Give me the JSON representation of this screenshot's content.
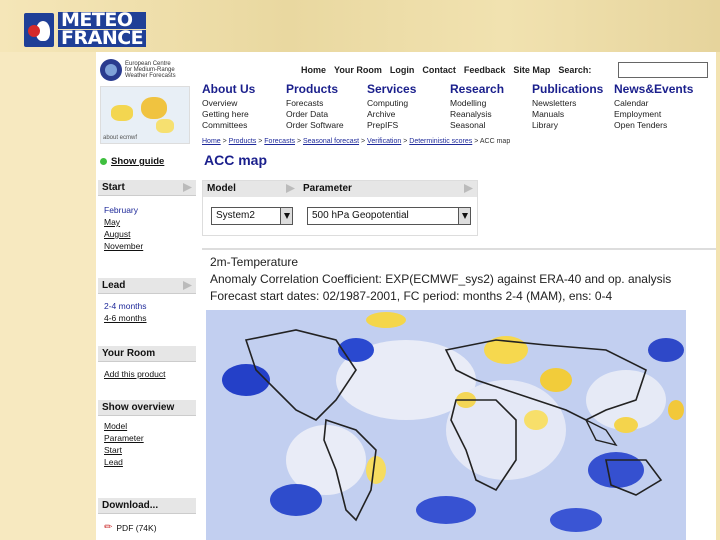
{
  "slide": {
    "logo_line1": "METEO",
    "logo_line2": "FRANCE"
  },
  "ecmwf": {
    "name_lines": [
      "European Centre",
      "for Medium-Range",
      "Weather Forecasts"
    ],
    "thumb_caption": "about ecmwf"
  },
  "topnav": {
    "items": [
      "Home",
      "Your Room",
      "Login",
      "Contact",
      "Feedback",
      "Site Map",
      "Search:"
    ]
  },
  "mainnav": [
    {
      "title": "About Us",
      "items": [
        "Overview",
        "Getting here",
        "Committees"
      ]
    },
    {
      "title": "Products",
      "items": [
        "Forecasts",
        "Order Data",
        "Order Software"
      ]
    },
    {
      "title": "Services",
      "items": [
        "Computing",
        "Archive",
        "PrepIFS"
      ]
    },
    {
      "title": "Research",
      "items": [
        "Modelling",
        "Reanalysis",
        "Seasonal"
      ]
    },
    {
      "title": "Publications",
      "items": [
        "Newsletters",
        "Manuals",
        "Library"
      ]
    },
    {
      "title": "News&Events",
      "items": [
        "Calendar",
        "Employment",
        "Open Tenders"
      ]
    }
  ],
  "breadcrumb": {
    "items": [
      "Home",
      "Products",
      "Forecasts",
      "Seasonal forecast",
      "Verification",
      "Deterministic scores"
    ],
    "current": "ACC map"
  },
  "sidebar": {
    "show_guide": "Show guide",
    "start": {
      "title": "Start",
      "items": [
        "February",
        "May",
        "August",
        "November"
      ],
      "selected": "February"
    },
    "lead": {
      "title": "Lead",
      "items": [
        "2-4 months",
        "4-6 months"
      ],
      "selected": "2-4 months"
    },
    "your_room": {
      "title": "Your Room",
      "items": [
        "Add this product"
      ]
    },
    "overview": {
      "title": "Show overview",
      "items": [
        "Model",
        "Parameter",
        "Start",
        "Lead"
      ]
    },
    "download": {
      "title": "Download...",
      "items": [
        "PDF (74K)"
      ]
    }
  },
  "content": {
    "title": "ACC map",
    "model_label": "Model",
    "model_value": "System2",
    "param_label": "Parameter",
    "param_value": "500 hPa Geopotential",
    "plot_lines": [
      "2m-Temperature",
      "Anomaly Correlation Coefficient: EXP(ECMWF_sys2) against ERA-40 and op. analysis",
      "Forecast start dates: 02/1987-2001, FC period: months 2-4 (MAM), ens: 0-4"
    ]
  }
}
